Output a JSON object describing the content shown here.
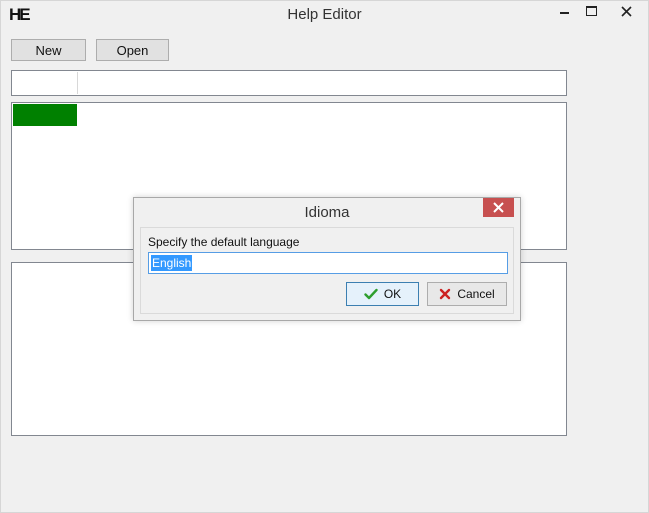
{
  "window": {
    "logo": "HE",
    "title": "Help Editor",
    "controls": {
      "minimize_icon": "minimize-icon",
      "maximize_icon": "maximize-icon",
      "close_icon": "close-icon"
    }
  },
  "toolbar": {
    "new_label": "New",
    "open_label": "Open"
  },
  "tree": {
    "selected_color": "#008000"
  },
  "dialog": {
    "title": "Idioma",
    "prompt": "Specify the default language",
    "language_value": "English",
    "ok_label": "OK",
    "cancel_label": "Cancel",
    "ok_icon": "checkmark-icon",
    "cancel_icon": "x-icon",
    "close_button_color": "#c75050"
  }
}
